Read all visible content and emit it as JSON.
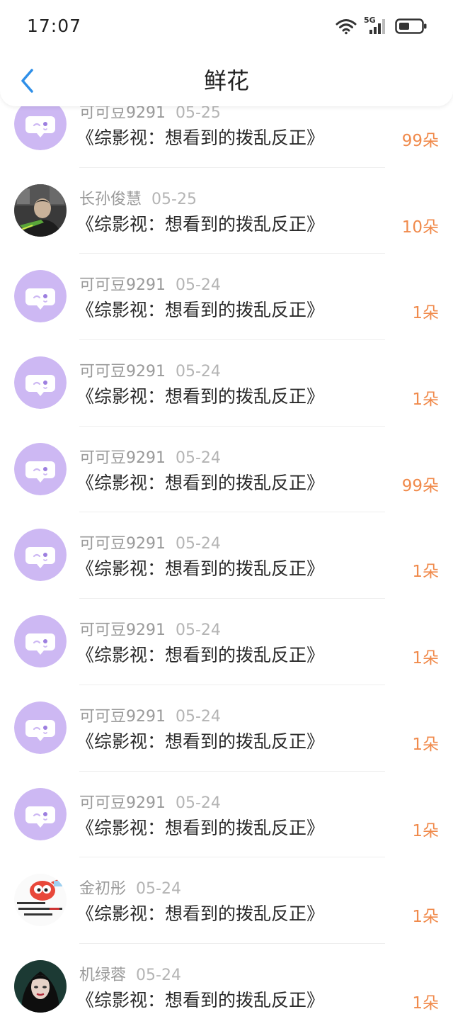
{
  "status_bar": {
    "time": "17:07",
    "network": "5G"
  },
  "header": {
    "title": "鲜花"
  },
  "colors": {
    "accent_blue": "#2f8fe8",
    "flower_count": "#f08a4b",
    "default_avatar": "#cdb8f3"
  },
  "gifts": [
    {
      "user": "可可豆9291",
      "date": "05-25",
      "book": "《综影视：想看到的拨乱反正》",
      "count": "99朵",
      "avatar": "default-chat-avatar"
    },
    {
      "user": "长孙俊慧",
      "date": "05-25",
      "book": "《综影视：想看到的拨乱反正》",
      "count": "10朵",
      "avatar": "photo-avatar-man"
    },
    {
      "user": "可可豆9291",
      "date": "05-24",
      "book": "《综影视：想看到的拨乱反正》",
      "count": "1朵",
      "avatar": "default-chat-avatar"
    },
    {
      "user": "可可豆9291",
      "date": "05-24",
      "book": "《综影视：想看到的拨乱反正》",
      "count": "1朵",
      "avatar": "default-chat-avatar"
    },
    {
      "user": "可可豆9291",
      "date": "05-24",
      "book": "《综影视：想看到的拨乱反正》",
      "count": "99朵",
      "avatar": "default-chat-avatar"
    },
    {
      "user": "可可豆9291",
      "date": "05-24",
      "book": "《综影视：想看到的拨乱反正》",
      "count": "1朵",
      "avatar": "default-chat-avatar"
    },
    {
      "user": "可可豆9291",
      "date": "05-24",
      "book": "《综影视：想看到的拨乱反正》",
      "count": "1朵",
      "avatar": "default-chat-avatar"
    },
    {
      "user": "可可豆9291",
      "date": "05-24",
      "book": "《综影视：想看到的拨乱反正》",
      "count": "1朵",
      "avatar": "default-chat-avatar"
    },
    {
      "user": "可可豆9291",
      "date": "05-24",
      "book": "《综影视：想看到的拨乱反正》",
      "count": "1朵",
      "avatar": "default-chat-avatar"
    },
    {
      "user": "金初彤",
      "date": "05-24",
      "book": "《综影视：想看到的拨乱反正》",
      "count": "1朵",
      "avatar": "cartoon-avatar"
    },
    {
      "user": "机绿蓉",
      "date": "05-24",
      "book": "《综影视：想看到的拨乱反正》",
      "count": "1朵",
      "avatar": "photo-avatar-woman"
    }
  ]
}
